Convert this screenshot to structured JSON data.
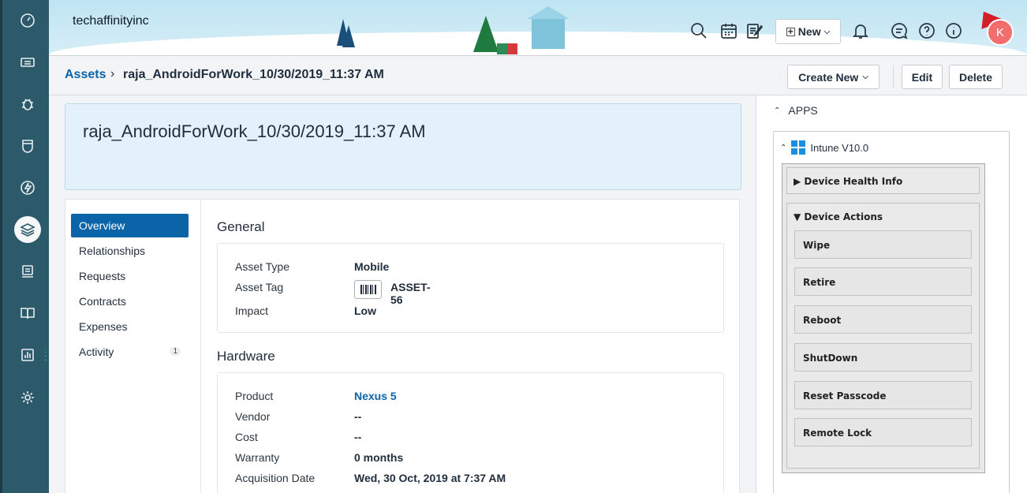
{
  "header": {
    "org_name": "techaffinityinc",
    "new_label": "New",
    "avatar_initial": "K"
  },
  "breadcrumb": {
    "parent": "Assets",
    "separator": "›",
    "current": "raja_AndroidForWork_10/30/2019_11:37 AM"
  },
  "toolbar": {
    "create_new_label": "Create New",
    "edit_label": "Edit",
    "delete_label": "Delete"
  },
  "asset": {
    "title": "raja_AndroidForWork_10/30/2019_11:37 AM"
  },
  "tabs": [
    {
      "label": "Overview"
    },
    {
      "label": "Relationships"
    },
    {
      "label": "Requests"
    },
    {
      "label": "Contracts"
    },
    {
      "label": "Expenses"
    },
    {
      "label": "Activity",
      "badge": "1"
    }
  ],
  "general": {
    "title": "General",
    "asset_type_label": "Asset Type",
    "asset_type": "Mobile",
    "asset_tag_label": "Asset Tag",
    "asset_tag": "ASSET-56",
    "impact_label": "Impact",
    "impact": "Low"
  },
  "hardware": {
    "title": "Hardware",
    "rows": [
      {
        "label": "Product",
        "value": "Nexus 5"
      },
      {
        "label": "Vendor",
        "value": "--"
      },
      {
        "label": "Cost",
        "value": "--"
      },
      {
        "label": "Warranty",
        "value": "0 months"
      },
      {
        "label": "Acquisition Date",
        "value": "Wed, 30 Oct, 2019 at 7:37 AM"
      }
    ]
  },
  "apps": {
    "title": "APPS",
    "app_name": "Intune V10.0",
    "health_info_label": "Device Health Info",
    "actions_label": "Device Actions",
    "actions": [
      "Wipe",
      "Retire",
      "Reboot",
      "ShutDown",
      "Reset Passcode",
      "Remote Lock"
    ]
  },
  "colors": {
    "rail": "#2d5a6b",
    "accent": "#0b64a8",
    "title_card": "#e3f1fb"
  }
}
